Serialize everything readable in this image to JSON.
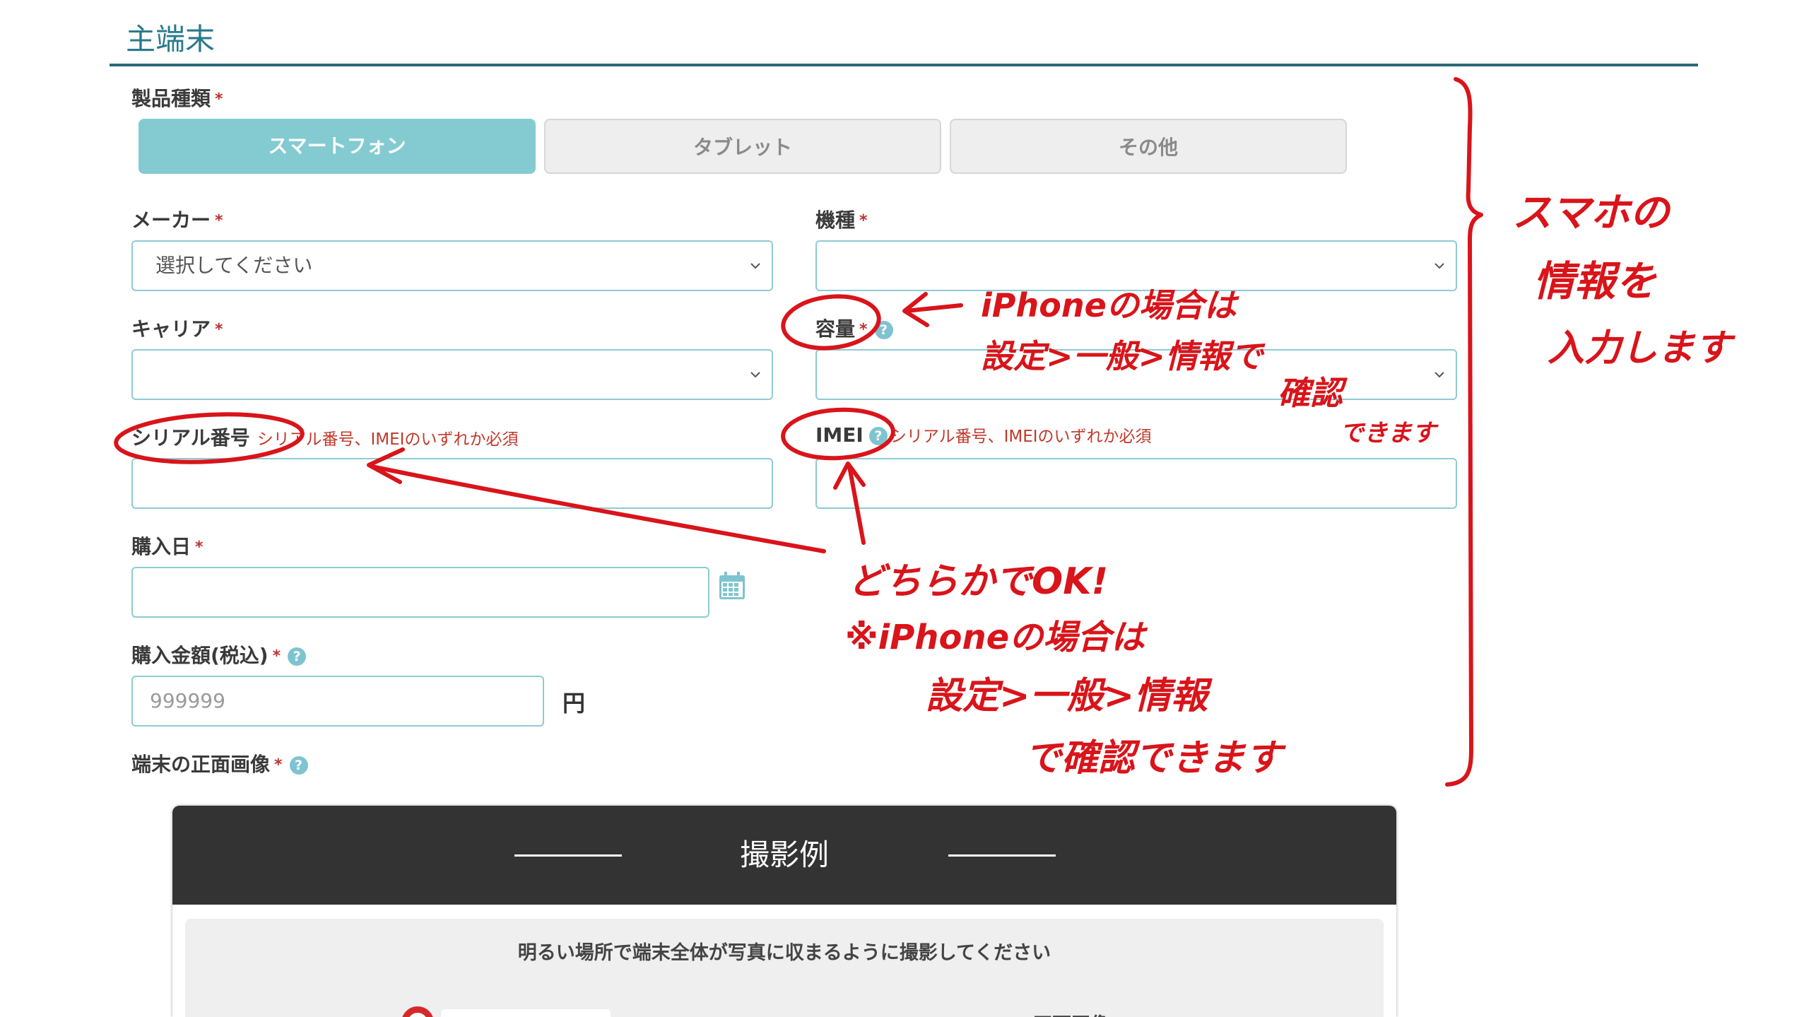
{
  "section": {
    "title": "主端末"
  },
  "product_type": {
    "label": "製品種類",
    "required_mark": "*",
    "options": [
      {
        "label": "スマートフォン",
        "selected": true
      },
      {
        "label": "タブレット",
        "selected": false
      },
      {
        "label": "その他",
        "selected": false
      }
    ]
  },
  "maker": {
    "label": "メーカー",
    "required_mark": "*",
    "value": "選択してください"
  },
  "model": {
    "label": "機種",
    "required_mark": "*",
    "value": ""
  },
  "carrier": {
    "label": "キャリア",
    "required_mark": "*",
    "value": ""
  },
  "capacity": {
    "label": "容量",
    "required_mark": "*",
    "value": ""
  },
  "serial": {
    "label": "シリアル番号",
    "note": "シリアル番号、IMEIのいずれか必須",
    "value": ""
  },
  "imei": {
    "label": "IMEI",
    "note": "シリアル番号、IMEIのいずれか必須",
    "value": ""
  },
  "purchase_date": {
    "label": "購入日",
    "required_mark": "*",
    "value": ""
  },
  "purchase_price": {
    "label": "購入金額(税込)",
    "required_mark": "*",
    "placeholder": "999999",
    "unit": "円"
  },
  "front_image": {
    "label": "端末の正面画像",
    "required_mark": "*"
  },
  "help_glyph": "?",
  "example": {
    "title": "撮影例",
    "instruction": "明るい場所で端末全体が写真に収まるように撮影してください",
    "front_label": "正面画像"
  },
  "annotations": {
    "color": "#d9141a",
    "right_note": [
      "スマホの",
      "情報を",
      "入力します"
    ],
    "capacity_note": [
      "iPhoneの場合は",
      "設定>一般>情報で",
      "確認",
      "できます"
    ],
    "either_note": [
      "どちらかでOK!",
      "※iPhoneの場合は",
      "設定>一般>情報",
      "で確認できます"
    ]
  },
  "colors": {
    "accent": "#84cbd1",
    "title": "#2a7a8c",
    "required": "#c03030",
    "input_border": "#8ecbd4",
    "dark_header": "#333333"
  }
}
